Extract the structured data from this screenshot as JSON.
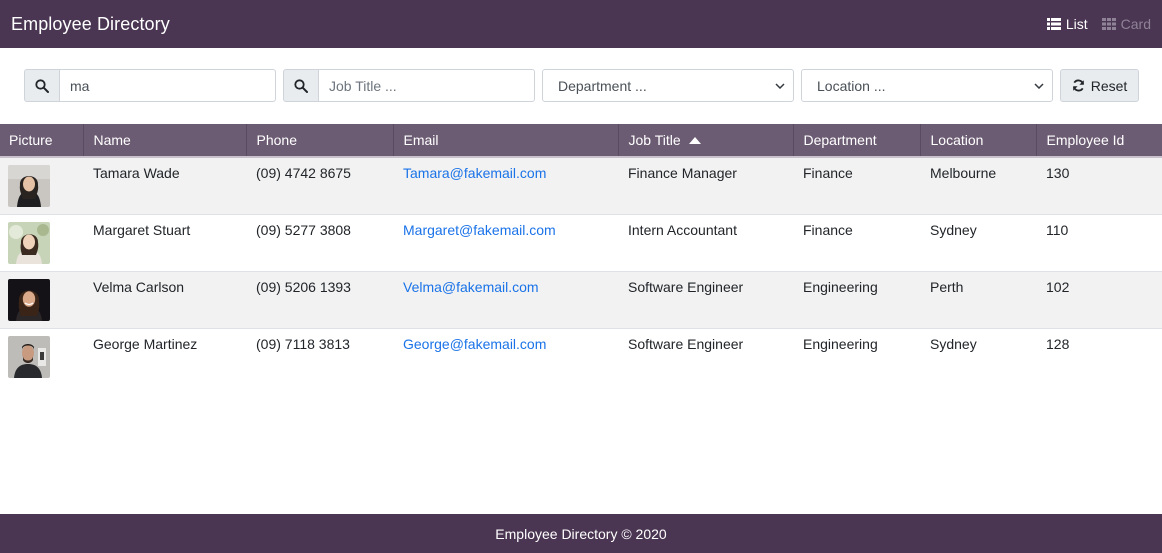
{
  "app": {
    "title": "Employee Directory",
    "view_list_label": "List",
    "view_card_label": "Card",
    "active_view": "list"
  },
  "filters": {
    "name_search_value": "ma",
    "job_title_placeholder": "Job Title ...",
    "department_selected": "Department ...",
    "location_selected": "Location ...",
    "reset_label": "Reset"
  },
  "table": {
    "columns": [
      "Picture",
      "Name",
      "Phone",
      "Email",
      "Job Title",
      "Department",
      "Location",
      "Employee Id"
    ],
    "sorted_column": "Job Title",
    "sort_direction": "ascending",
    "rows": [
      {
        "name": "Tamara Wade",
        "phone": "(09) 4742 8675",
        "email": "Tamara@fakemail.com",
        "job_title": "Finance Manager",
        "department": "Finance",
        "location": "Melbourne",
        "employee_id": "130"
      },
      {
        "name": "Margaret Stuart",
        "phone": "(09) 5277 3808",
        "email": "Margaret@fakemail.com",
        "job_title": "Intern Accountant",
        "department": "Finance",
        "location": "Sydney",
        "employee_id": "110"
      },
      {
        "name": "Velma Carlson",
        "phone": "(09) 5206 1393",
        "email": "Velma@fakemail.com",
        "job_title": "Software Engineer",
        "department": "Engineering",
        "location": "Perth",
        "employee_id": "102"
      },
      {
        "name": "George Martinez",
        "phone": "(09) 7118 3813",
        "email": "George@fakemail.com",
        "job_title": "Software Engineer",
        "department": "Engineering",
        "location": "Sydney",
        "employee_id": "128"
      }
    ]
  },
  "footer": {
    "text": "Employee Directory © 2020"
  },
  "colors": {
    "navbar": "#4a3552",
    "table_header": "#6c5c73",
    "link": "#1a73e8",
    "row_stripe": "#f2f2f2"
  }
}
